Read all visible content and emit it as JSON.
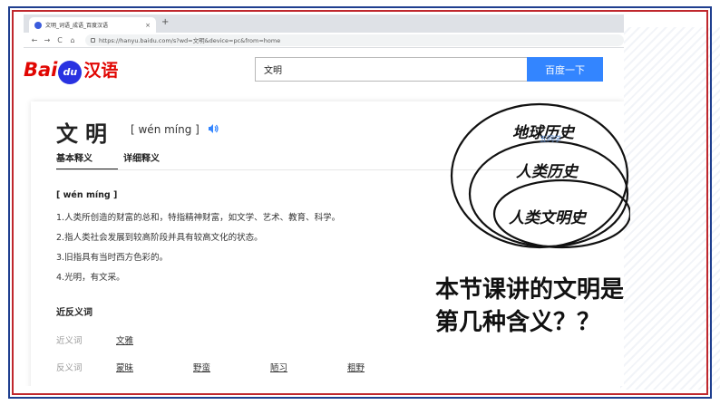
{
  "browser": {
    "tab_title": "文明_词语_成语_百度汉语",
    "tab_close": "×",
    "new_tab": "+",
    "back": "←",
    "forward": "→",
    "reload": "C",
    "home": "⌂",
    "url": "https://hanyu.baidu.com/s?wd=文明&device=pc&from=home"
  },
  "baidu": {
    "logo_bai": "Bai",
    "logo_du": "du",
    "logo_hanyu": "汉语",
    "search_value": "文明",
    "search_button": "百度一下"
  },
  "entry": {
    "word": "文明",
    "pinyin": "[ wén míng ]",
    "tab_basic": "基本释义",
    "tab_detail": "详细释义",
    "def_pinyin": "[ wén míng ]",
    "definitions": [
      "1.人类所创造的财富的总和，特指精神财富，如文学、艺术、教育、科学。",
      "2.指人类社会发展到较高阶段并具有较高文化的状态。",
      "3.旧指具有当时西方色彩的。",
      "4.光明，有文采。"
    ],
    "synonyms_title": "近反义词",
    "synonym_label": "近义词",
    "synonyms": [
      "文雅"
    ],
    "antonym_label": "反义词",
    "antonyms": [
      "蒙昧",
      "野蛮",
      "陋习",
      "粗野"
    ]
  },
  "diagram": {
    "outer": "地球历史",
    "middle": "人类历史",
    "inner": "人类文明史",
    "watermark": "五同学"
  },
  "question": {
    "line1": "本节课讲的文明是",
    "line2": "第几种含义？？"
  },
  "colors": {
    "frame_blue": "#1f3f8f",
    "frame_red": "#c0272d",
    "baidu_blue": "#3385ff",
    "baidu_red": "#e10602"
  }
}
